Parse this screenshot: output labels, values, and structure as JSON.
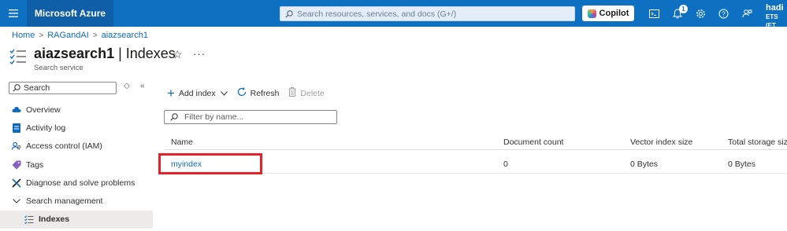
{
  "topbar": {
    "brand": "Microsoft Azure",
    "search_placeholder": "Search resources, services, and docs (G+/)",
    "copilot_label": "Copilot",
    "notification_count": "1",
    "user_name": "hadi",
    "user_org": "ETS (ET"
  },
  "breadcrumb": [
    "Home",
    "RAGandAI",
    "aiazsearch1"
  ],
  "header": {
    "resource_name": "aiazsearch1",
    "separator": " | ",
    "page_name": "Indexes",
    "subtitle": "Search service"
  },
  "sidebar": {
    "search_placeholder": "Search",
    "items": [
      {
        "label": "Overview",
        "icon": "cloud-icon"
      },
      {
        "label": "Activity log",
        "icon": "activity-log-icon"
      },
      {
        "label": "Access control (IAM)",
        "icon": "iam-icon"
      },
      {
        "label": "Tags",
        "icon": "tag-icon"
      },
      {
        "label": "Diagnose and solve problems",
        "icon": "wrench-icon"
      },
      {
        "label": "Search management",
        "icon": "chevron-down-icon"
      },
      {
        "label": "Indexes",
        "icon": "indexes-icon"
      }
    ]
  },
  "commands": {
    "add_index": "Add index",
    "refresh": "Refresh",
    "delete": "Delete"
  },
  "filter": {
    "placeholder": "Filter by name..."
  },
  "table": {
    "columns": [
      "Name",
      "Document count",
      "Vector index size",
      "Total storage size"
    ],
    "rows": [
      {
        "name": "myindex",
        "document_count": "0",
        "vector_index_size": "0 Bytes",
        "total_storage_size": "0 Bytes"
      }
    ]
  },
  "colors": {
    "topbar": "#0e70c0",
    "brand_bg": "#0f5fa8",
    "link": "#0f6cbd",
    "highlight_box": "#e8202a"
  }
}
